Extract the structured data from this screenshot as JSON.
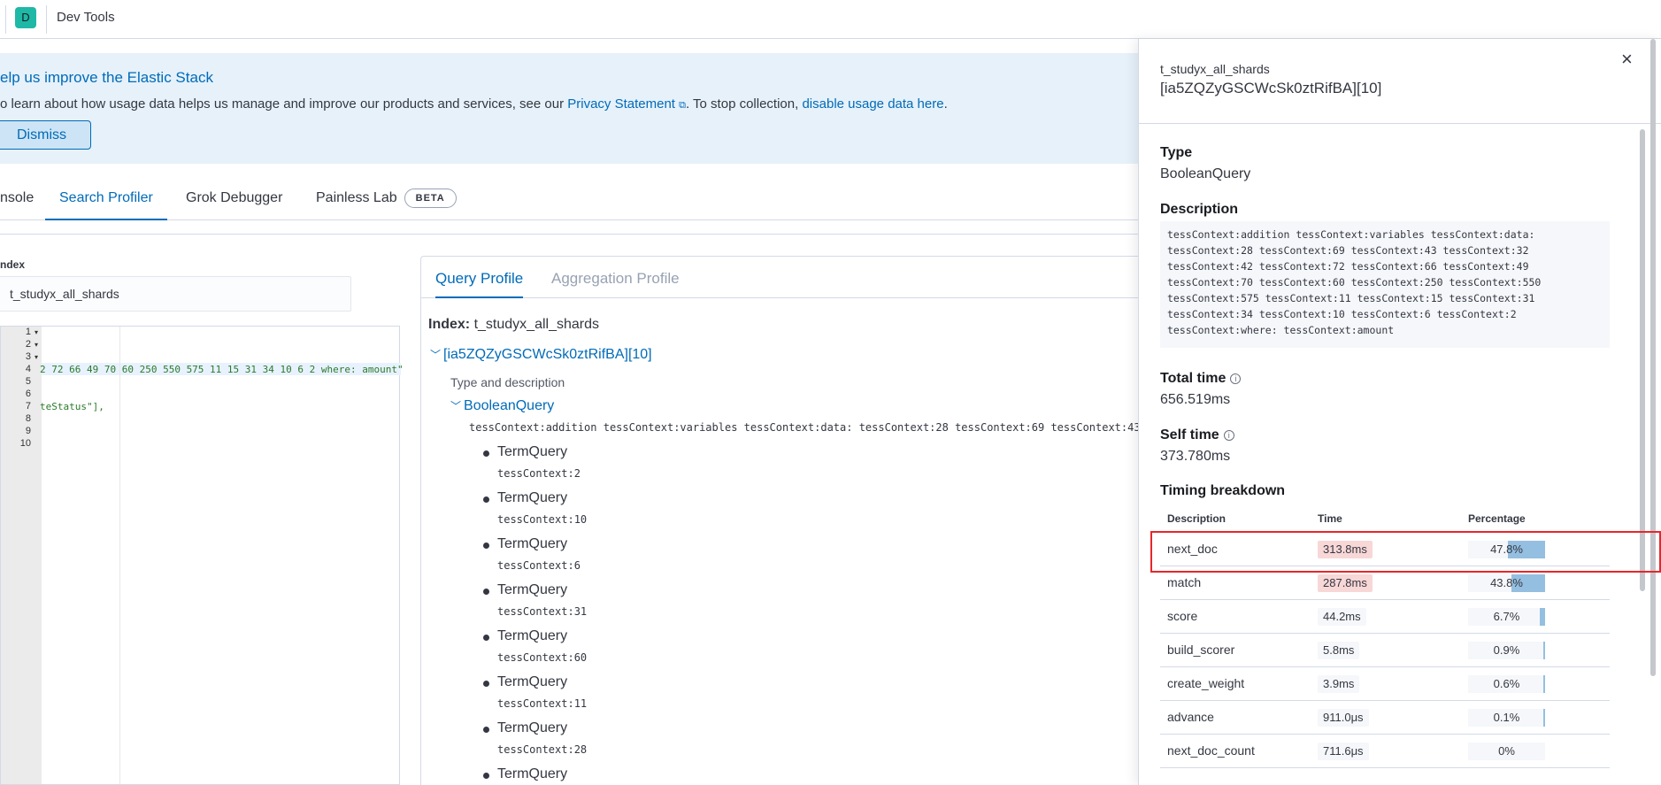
{
  "header": {
    "avatar_letter": "D",
    "app_title": "Dev Tools"
  },
  "callout": {
    "title": "elp us improve the Elastic Stack",
    "body_prefix": "o learn about how usage data helps us manage and improve our products and services, see our ",
    "privacy_link": "Privacy Statement",
    "body_middle": ". To stop collection, ",
    "disable_link": "disable usage data here",
    "body_suffix": ".",
    "dismiss_label": "Dismiss"
  },
  "tabs": {
    "console": "nsole",
    "search_profiler": "Search Profiler",
    "grok_debugger": "Grok Debugger",
    "painless_lab": "Painless Lab",
    "beta_badge": "BETA"
  },
  "index": {
    "label": "ndex",
    "value": "t_studyx_all_shards"
  },
  "editor": {
    "line_numbers": [
      "1",
      "2",
      "3",
      "4",
      "5",
      "6",
      "7",
      "8",
      "9",
      "10"
    ],
    "line4": "2 72 66 49 70 60 250 550 575 11 15 31 34 10 6 2 where: amount\"",
    "line7": "teStatus\"],"
  },
  "results": {
    "tab_query": "Query Profile",
    "tab_aggregation": "Aggregation Profile",
    "index_label": "Index:",
    "index_value": "t_studyx_all_shards",
    "shard": "[ia5ZQZyGSCWcSk0ztRifBA][10]",
    "type_desc_label": "Type and description",
    "root_type": "BooleanQuery",
    "root_desc": "tessContext:addition tessContext:variables tessContext:data: tessContext:28 tessContext:69 tessContext:43",
    "children": [
      {
        "type": "TermQuery",
        "desc": "tessContext:2"
      },
      {
        "type": "TermQuery",
        "desc": "tessContext:10"
      },
      {
        "type": "TermQuery",
        "desc": "tessContext:6"
      },
      {
        "type": "TermQuery",
        "desc": "tessContext:31"
      },
      {
        "type": "TermQuery",
        "desc": "tessContext:60"
      },
      {
        "type": "TermQuery",
        "desc": "tessContext:11"
      },
      {
        "type": "TermQuery",
        "desc": "tessContext:28"
      },
      {
        "type": "TermQuery",
        "desc": ""
      }
    ]
  },
  "flyout": {
    "index_name": "t_studyx_all_shards",
    "shard": "[ia5ZQZyGSCWcSk0ztRifBA][10]",
    "type_label": "Type",
    "type_value": "BooleanQuery",
    "description_label": "Description",
    "description_value": "tessContext:addition tessContext:variables tessContext:data:\ntessContext:28 tessContext:69 tessContext:43 tessContext:32\ntessContext:42 tessContext:72 tessContext:66 tessContext:49\ntessContext:70 tessContext:60 tessContext:250 tessContext:550\ntessContext:575 tessContext:11 tessContext:15 tessContext:31\ntessContext:34 tessContext:10 tessContext:6 tessContext:2\ntessContext:where: tessContext:amount",
    "total_time_label": "Total time",
    "total_time_value": "656.519ms",
    "self_time_label": "Self time",
    "self_time_value": "373.780ms",
    "breakdown_label": "Timing breakdown",
    "info_glyph": "i",
    "close_glyph": "×",
    "columns": {
      "description": "Description",
      "time": "Time",
      "percentage": "Percentage"
    },
    "rows": [
      {
        "name": "next_doc",
        "time": "313.8ms",
        "percentage": "47.8%",
        "fraction": 0.478,
        "hot": true
      },
      {
        "name": "match",
        "time": "287.8ms",
        "percentage": "43.8%",
        "fraction": 0.438,
        "hot": true
      },
      {
        "name": "score",
        "time": "44.2ms",
        "percentage": "6.7%",
        "fraction": 0.067,
        "hot": false
      },
      {
        "name": "build_scorer",
        "time": "5.8ms",
        "percentage": "0.9%",
        "fraction": 0.009,
        "hot": false
      },
      {
        "name": "create_weight",
        "time": "3.9ms",
        "percentage": "0.6%",
        "fraction": 0.006,
        "hot": false
      },
      {
        "name": "advance",
        "time": "911.0μs",
        "percentage": "0.1%",
        "fraction": 0.001,
        "hot": false
      },
      {
        "name": "next_doc_count",
        "time": "711.6μs",
        "percentage": "0%",
        "fraction": 0.0,
        "hot": false
      }
    ]
  },
  "colors": {
    "accent": "#006bb8",
    "highlight_border": "#e7262b",
    "hot_badge": "#f8d7d7"
  }
}
